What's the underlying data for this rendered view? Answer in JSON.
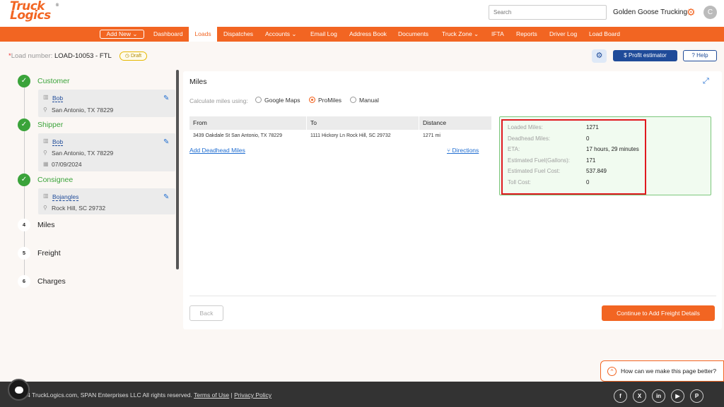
{
  "header": {
    "logo_line1": "Truck",
    "logo_line2": "Logics",
    "logo_mark": "®",
    "search_placeholder": "Search",
    "company": "Golden Goose Trucking",
    "avatar_initial": "C"
  },
  "nav": {
    "add_new": "Add New",
    "items": [
      "Dashboard",
      "Loads",
      "Dispatches",
      "Accounts",
      "Email Log",
      "Address Book",
      "Documents",
      "Truck Zone",
      "IFTA",
      "Reports",
      "Driver Log",
      "Load Board"
    ],
    "active": "Loads"
  },
  "load": {
    "asterisk": "*",
    "label": "Load number:",
    "number": "LOAD-10053 - FTL",
    "status": "Draft",
    "profit_label": "$ Profit estimator",
    "help_label": "Help"
  },
  "steps": {
    "customer": {
      "title": "Customer",
      "name": "Bob",
      "addr": "San Antonio, TX 78229"
    },
    "shipper": {
      "title": "Shipper",
      "name": "Bob",
      "addr": "San Antonio, TX 78229",
      "date": "07/09/2024"
    },
    "consignee": {
      "title": "Consignee",
      "name": "Bojangles",
      "addr": "Rock Hill, SC 29732"
    },
    "miles": {
      "num": "4",
      "title": "Miles"
    },
    "freight": {
      "num": "5",
      "title": "Freight"
    },
    "charges": {
      "num": "6",
      "title": "Charges"
    }
  },
  "miles": {
    "title": "Miles",
    "calc_label": "Calculate miles using:",
    "options": [
      "Google Maps",
      "ProMiles",
      "Manual"
    ],
    "selected": "ProMiles",
    "columns": [
      "From",
      "To",
      "Distance"
    ],
    "row": {
      "from": "3439 Oakdale St San Antonio, TX 78229",
      "to": "1111 Hickory Ln Rock Hill, SC 29732",
      "distance": "1271 mi"
    },
    "deadhead_link": "Add Deadhead Miles",
    "directions_link": "Directions",
    "summary": [
      {
        "k": "Loaded Miles:",
        "v": "1271"
      },
      {
        "k": "Deadhead Miles:",
        "v": "0"
      },
      {
        "k": "ETA:",
        "v": "17 hours, 29 minutes"
      },
      {
        "k": "Estimated Fuel(Gallons):",
        "v": "171"
      },
      {
        "k": "Estimated Fuel Cost:",
        "v": "537.849"
      },
      {
        "k": "Toll Cost:",
        "v": "0"
      }
    ],
    "back": "Back",
    "continue": "Continue to Add Freight Details"
  },
  "feedback": "How can we make this page better?",
  "footer": {
    "copyright": "2024 TruckLogics.com, SPAN Enterprises LLC All rights reserved.",
    "terms": "Terms of Use",
    "separator": "|",
    "privacy": "Privacy Policy"
  },
  "social_icons": [
    "facebook-icon",
    "x-icon",
    "linkedin-icon",
    "youtube-icon",
    "pinterest-icon"
  ],
  "colors": {
    "brand": "#f26522",
    "primary": "#1f4b99",
    "success": "#3aa33a",
    "highlight": "#e0191f"
  }
}
